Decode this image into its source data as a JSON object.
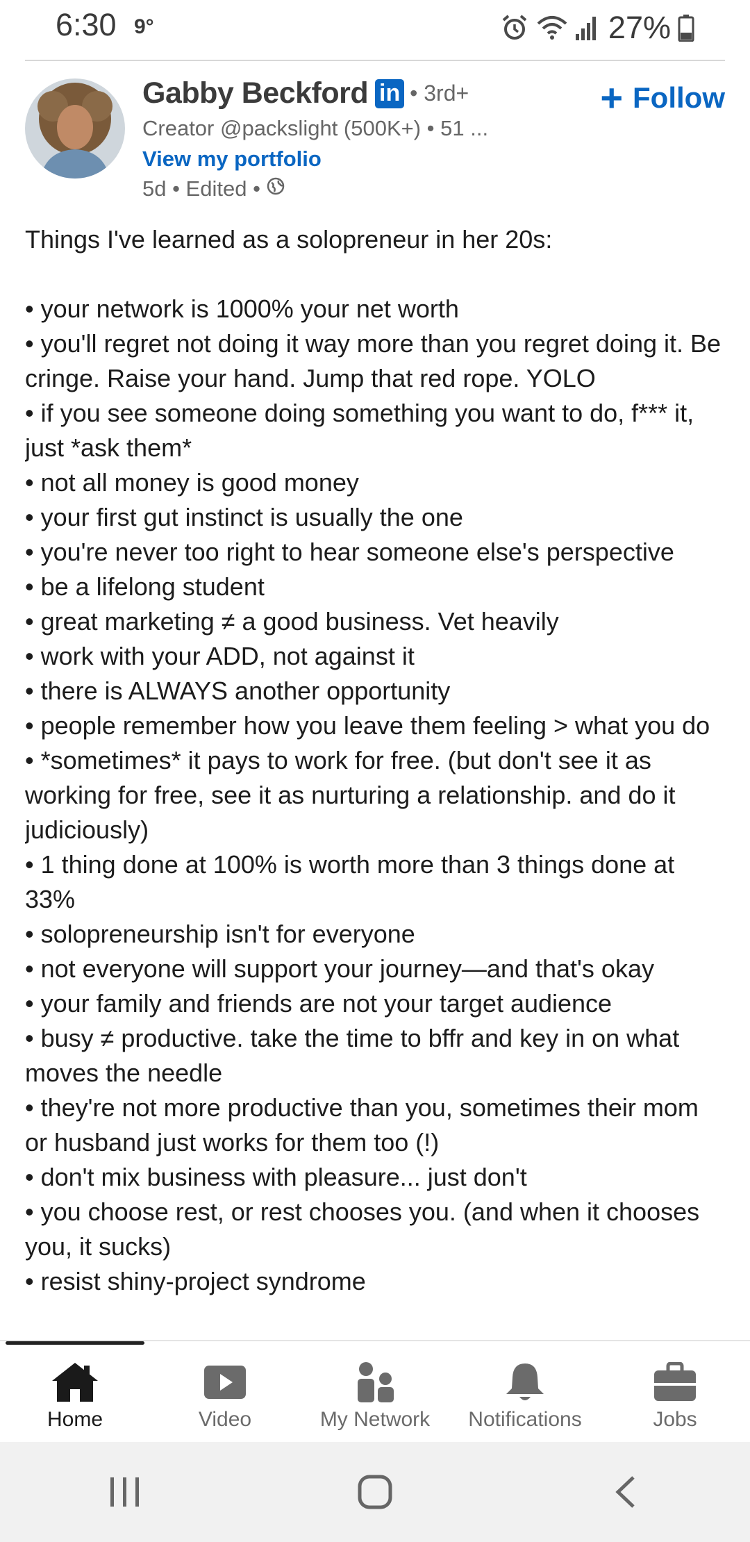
{
  "status_bar": {
    "time": "6:30",
    "temperature": "9°",
    "battery": "27%",
    "icons": [
      "alarm-icon",
      "wifi-icon",
      "signal-icon",
      "battery-icon"
    ]
  },
  "post": {
    "author": {
      "name": "Gabby Beckford",
      "badge": "in",
      "degree": "• 3rd+",
      "headline": "Creator @packslight (500K+) • 51 ...",
      "portfolio_link": "View my portfolio",
      "meta": "5d • Edited •"
    },
    "follow_label": "Follow",
    "intro": "Things I've learned as a solopreneur in her 20s:",
    "lines": [
      "• your network is 1000% your net worth",
      "• you'll regret not doing it way more than you regret doing it. Be cringe. Raise your hand. Jump that red rope. YOLO",
      "• if you see someone doing something you want to do, f*** it, just *ask them*",
      "• not all money is good money",
      "• your first gut instinct is usually the one",
      "• you're never too right to hear someone else's perspective",
      "• be a lifelong student",
      "• great marketing ≠ a good business. Vet heavily",
      "• work with your ADD, not against it",
      "• there is ALWAYS another opportunity",
      "• people remember how you leave them feeling > what you do",
      "• *sometimes* it pays to work for free. (but don't see it as working for free, see it as nurturing a relationship. and do it judiciously)",
      "• 1 thing done at 100% is worth more than 3 things done at 33%",
      "• solopreneurship isn't for everyone",
      "• not everyone will support your journey—and that's okay",
      "• your family and friends are not your target audience",
      "• busy ≠ productive. take the time to bffr and key in on what moves the needle",
      "• they're not more productive than you, sometimes their mom or husband just works for them too (!)",
      "• don't mix business with pleasure... just don't",
      "• you choose rest, or rest chooses you. (and when it chooses you, it sucks)",
      "• resist shiny-project syndrome"
    ]
  },
  "bottom_nav": {
    "items": [
      {
        "label": "Home",
        "icon": "home-icon",
        "active": true
      },
      {
        "label": "Video",
        "icon": "video-icon",
        "active": false
      },
      {
        "label": "My Network",
        "icon": "network-icon",
        "active": false
      },
      {
        "label": "Notifications",
        "icon": "bell-icon",
        "active": false
      },
      {
        "label": "Jobs",
        "icon": "briefcase-icon",
        "active": false
      }
    ]
  },
  "system_nav": [
    "recents-icon",
    "home-circle-icon",
    "back-icon"
  ],
  "colors": {
    "linkedin_blue": "#0a66c2",
    "text": "#1c1c1c",
    "muted": "#666666"
  }
}
